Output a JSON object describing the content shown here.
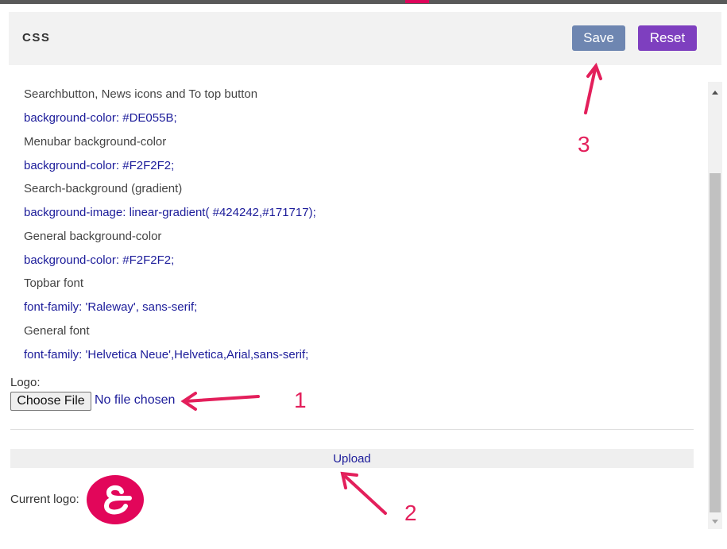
{
  "header": {
    "title": "CSS",
    "save_label": "Save",
    "reset_label": "Reset"
  },
  "css_settings": [
    {
      "label": "Searchbutton, News icons and To top button",
      "rule": "background-color: #DE055B;"
    },
    {
      "label": "Menubar background-color",
      "rule": "background-color: #F2F2F2;"
    },
    {
      "label": "Search-background (gradient)",
      "rule": "background-image: linear-gradient( #424242,#171717);"
    },
    {
      "label": "General background-color",
      "rule": "background-color: #F2F2F2;"
    },
    {
      "label": "Topbar font",
      "rule": "font-family: 'Raleway', sans-serif;"
    },
    {
      "label": "General font",
      "rule": "font-family: 'Helvetica Neue',Helvetica,Arial,sans-serif;"
    }
  ],
  "logo": {
    "label": "Logo:",
    "choose_file_label": "Choose File",
    "file_status": "No file chosen",
    "upload_label": "Upload",
    "current_logo_label": "Current logo:"
  },
  "annotations": {
    "one": "1",
    "two": "2",
    "three": "3"
  },
  "icons": {
    "logo": "ampersand-logo-icon",
    "scroll_up": "triangle-up-icon",
    "scroll_down": "triangle-down-icon"
  },
  "colors": {
    "accent": "#DE055B",
    "save_button": "#6e86b1",
    "reset_button": "#7e3fbf",
    "annotation": "#e31f5b",
    "link": "#1c1c9a"
  }
}
